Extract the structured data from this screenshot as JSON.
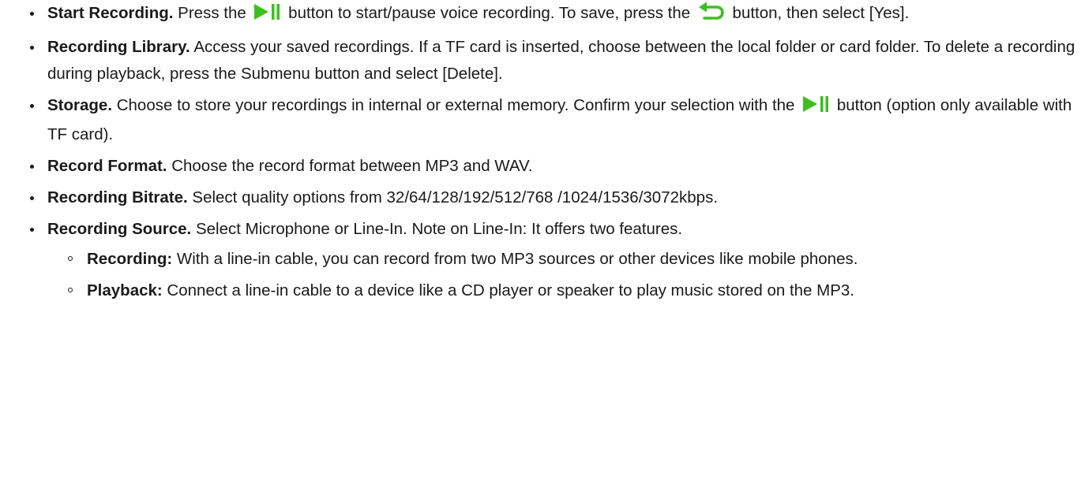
{
  "colors": {
    "icon_green": "#3dbf1f",
    "text": "#1a1a1a"
  },
  "icons": {
    "play_pause": "play-pause-icon",
    "back": "back-arrow-icon"
  },
  "items": [
    {
      "title": "Start Recording.",
      "t1": " Press the ",
      "t2": " button to start/pause voice recording. To save, press the ",
      "t3": " button, then select [Yes]."
    },
    {
      "title": "Recording Library.",
      "t1": " Access your saved recordings. If a TF card is inserted, choose between the local folder or card folder. To delete a recording during playback, press the Submenu button and select [Delete]."
    },
    {
      "title": "Storage.",
      "t1": " Choose to store your recordings in internal or external memory. Confirm your selection with the ",
      "t2": " button (option only available with TF card)."
    },
    {
      "title": "Record Format.",
      "t1": " Choose the record format between MP3 and WAV."
    },
    {
      "title": "Recording Bitrate.",
      "t1": " Select quality options from 32/64/128/192/512/768 /1024/1536/3072kbps."
    },
    {
      "title": "Recording Source.",
      "t1": " Select Microphone or Line-In. Note on Line-In: It offers two features.",
      "sub": [
        {
          "title": "Recording:",
          "t1": " With a line-in cable, you can record from two MP3 sources or other devices like mobile phones."
        },
        {
          "title": "Playback:",
          "t1": " Connect a line-in cable to a device like a CD player or speaker to play music stored on the MP3."
        }
      ]
    }
  ]
}
